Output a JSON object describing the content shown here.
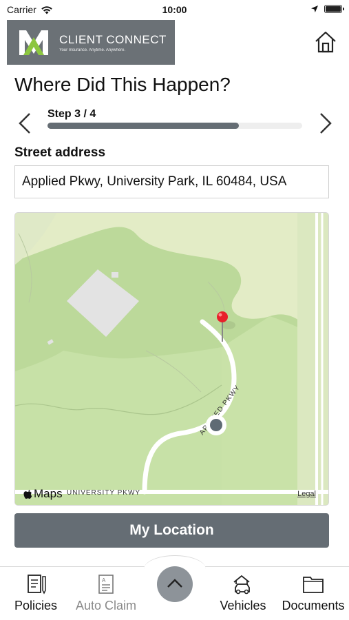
{
  "status_bar": {
    "carrier": "Carrier",
    "time": "10:00",
    "wifi_icon": "wifi-icon",
    "location_icon": "location-arrow-icon",
    "battery_icon": "battery-icon"
  },
  "header": {
    "logo_title": "CLIENT CONNECT",
    "logo_tagline": "Your Insurance. Anytime. Anywhere.",
    "home_icon": "home-icon"
  },
  "page": {
    "title": "Where Did This Happen?",
    "step_label": "Step 3 / 4",
    "step_progress_percent": 75
  },
  "form": {
    "address_label": "Street address",
    "address_value": "Applied Pkwy, University Park, IL 60484, USA"
  },
  "map": {
    "attribution": "Maps",
    "road_label_bottom": "UNIVERSITY PKWY",
    "road_label_curve": "APPLIED PKWY",
    "legal": "Legal"
  },
  "actions": {
    "my_location": "My Location"
  },
  "tabs": [
    {
      "label": "Policies",
      "icon": "policies-icon",
      "active": true
    },
    {
      "label": "Auto Claim",
      "icon": "auto-claim-icon",
      "active": false
    },
    {
      "label": "Vehicles",
      "icon": "vehicles-icon",
      "active": true
    },
    {
      "label": "Documents",
      "icon": "documents-icon",
      "active": true
    }
  ],
  "colors": {
    "brand_gray": "#656d74",
    "logo_green": "#8cc63f",
    "map_park": "#c9e2a6",
    "pin_red": "#e8202a",
    "location_dot": "#5f6b74"
  }
}
